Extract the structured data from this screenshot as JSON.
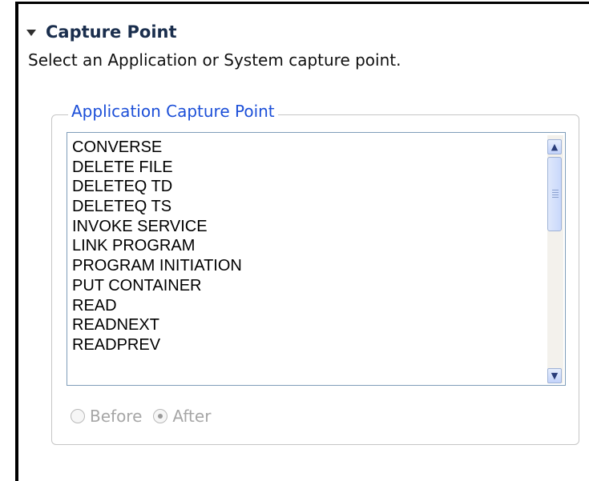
{
  "section": {
    "title": "Capture Point",
    "description": "Select an Application or System capture point."
  },
  "group": {
    "legend": "Application Capture Point",
    "items": [
      "CONVERSE",
      "DELETE FILE",
      "DELETEQ TD",
      "DELETEQ TS",
      "INVOKE SERVICE",
      "LINK PROGRAM",
      "PROGRAM INITIATION",
      "PUT CONTAINER",
      "READ",
      "READNEXT",
      "READPREV"
    ]
  },
  "options": {
    "before_label": "Before",
    "after_label": "After",
    "selected": "After",
    "enabled": false
  },
  "icons": {
    "twisty": "expanded-triangle-icon",
    "scroll_up": "scroll-up-arrow-icon",
    "scroll_down": "scroll-down-arrow-icon"
  },
  "scrollbar": {
    "thumb_position": 0
  }
}
